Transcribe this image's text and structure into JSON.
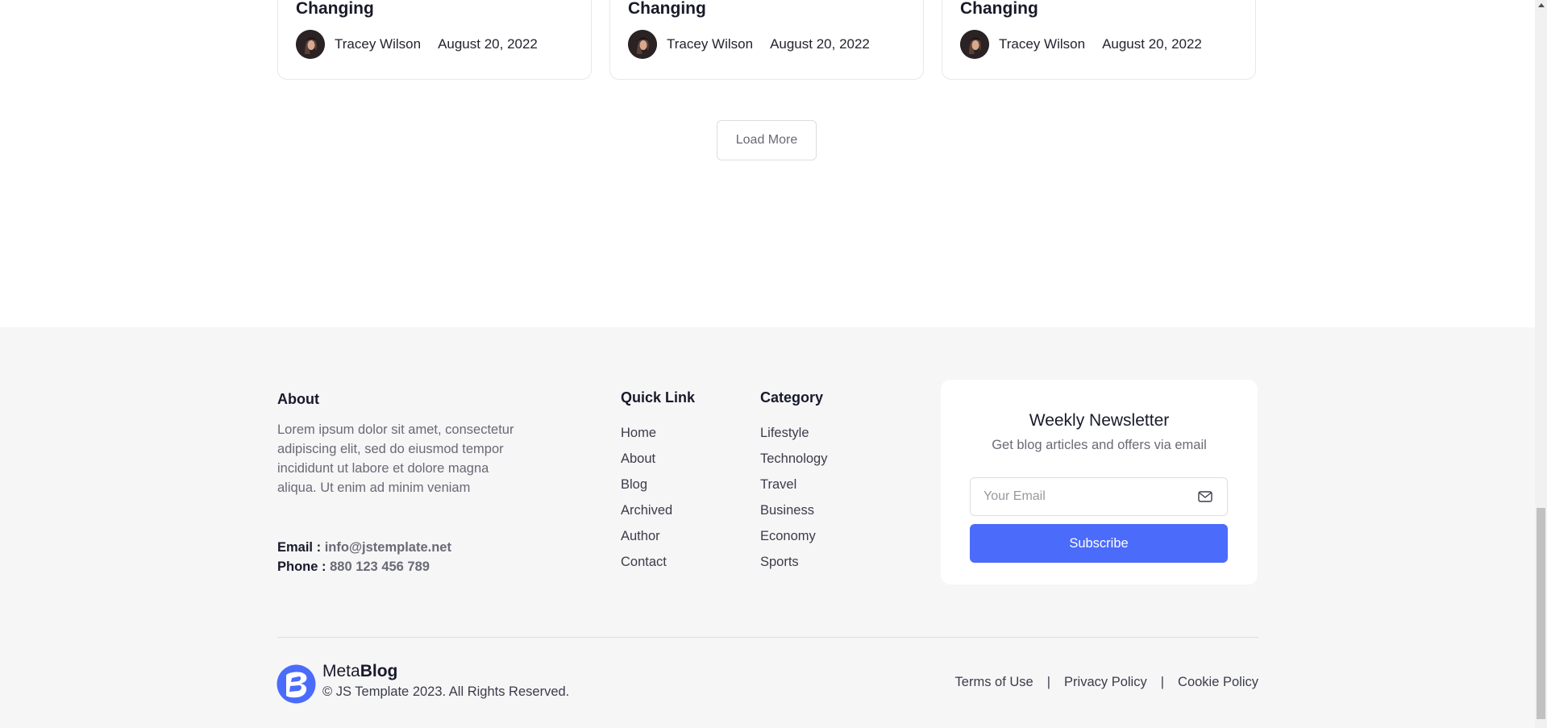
{
  "cards": [
    {
      "title": "Changing",
      "author": "Tracey Wilson",
      "date": "August 20, 2022"
    },
    {
      "title": "Changing",
      "author": "Tracey Wilson",
      "date": "August 20, 2022"
    },
    {
      "title": "Changing",
      "author": "Tracey Wilson",
      "date": "August 20, 2022"
    }
  ],
  "load_more_label": "Load More",
  "footer": {
    "about": {
      "heading": "About",
      "text": "Lorem ipsum dolor sit amet, consectetur adipiscing elit, sed do eiusmod tempor incididunt ut labore et dolore magna aliqua. Ut enim ad minim veniam",
      "email_label": "Email :",
      "email": "info@jstemplate.net",
      "phone_label": "Phone :",
      "phone": "880 123 456 789"
    },
    "quick_link": {
      "heading": "Quick Link",
      "items": [
        "Home",
        "About",
        "Blog",
        "Archived",
        "Author",
        "Contact"
      ]
    },
    "category": {
      "heading": "Category",
      "items": [
        "Lifestyle",
        "Technology",
        "Travel",
        "Business",
        "Economy",
        "Sports"
      ]
    },
    "newsletter": {
      "heading": "Weekly Newsletter",
      "subheading": "Get blog articles and offers via email",
      "email_placeholder": "Your Email",
      "subscribe_label": "Subscribe"
    },
    "brand": {
      "name_light": "Meta",
      "name_bold": "Blog"
    },
    "copyright": "© JS Template 2023. All Rights Reserved.",
    "legal_links": [
      "Terms of Use",
      "Privacy Policy",
      "Cookie Policy"
    ],
    "legal_separator": "|"
  },
  "colors": {
    "accent": "#4b6bfb",
    "footer_bg": "#f6f6f7",
    "text_muted": "#696a75"
  },
  "icons": {
    "mail": "envelope-icon",
    "logo": "metablog-logo",
    "avatar": "author-avatar"
  }
}
